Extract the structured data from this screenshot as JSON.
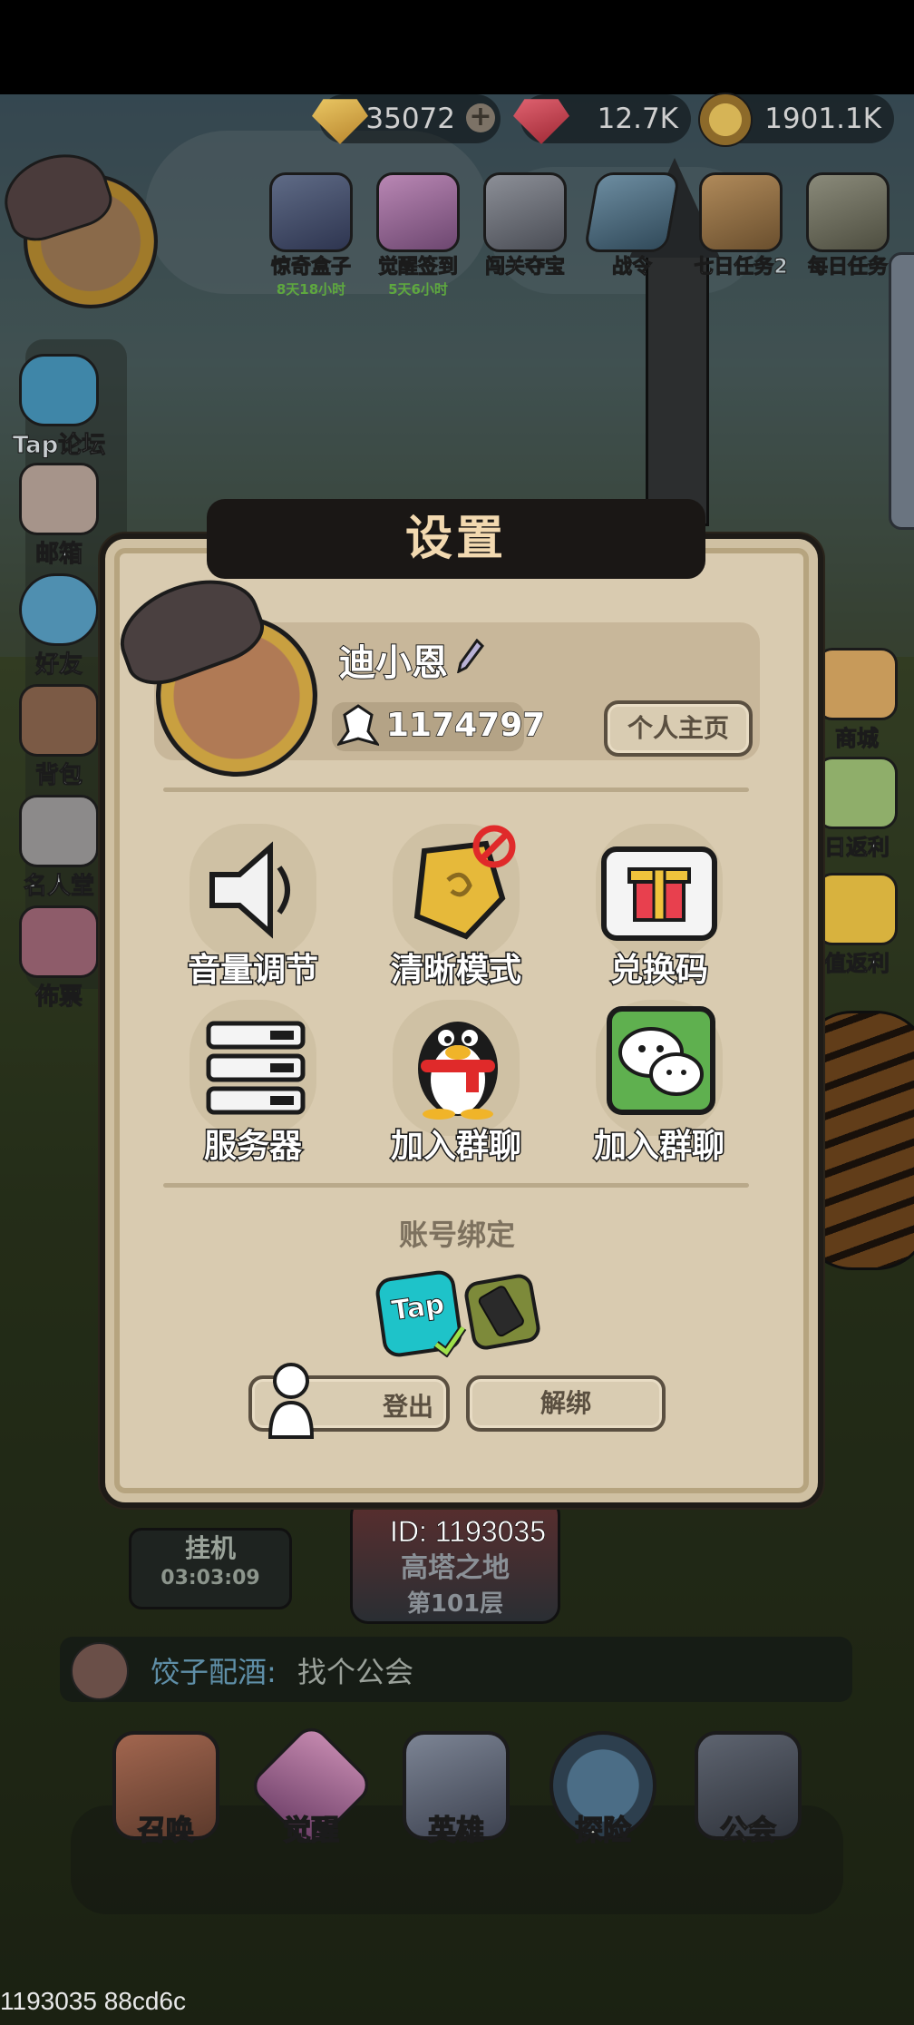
{
  "currency": {
    "gold": "35072",
    "ruby": "12.7K",
    "coin": "1901.1K"
  },
  "events": [
    {
      "label": "惊奇盒子",
      "timer": "8天18小时"
    },
    {
      "label": "觉醒签到",
      "timer": "5天6小时"
    },
    {
      "label": "闯关夺宝",
      "timer": ""
    },
    {
      "label": "战令",
      "timer": ""
    },
    {
      "label": "七日任务2",
      "timer": ""
    },
    {
      "label": "每日任务",
      "timer": ""
    }
  ],
  "side_menu": [
    "Tap论坛",
    "邮箱",
    "好友",
    "背包",
    "名人堂",
    "佈票"
  ],
  "right_menu": [
    "商城",
    "日返利",
    "值返利"
  ],
  "idle": {
    "label": "挂机",
    "time": "03:03:09"
  },
  "tower": {
    "label": "高塔之地",
    "floor": "第101层"
  },
  "chat": {
    "user": "饺子配酒:",
    "message": "找个公会"
  },
  "bottom_nav": [
    "召唤",
    "觉醒",
    "英雄",
    "探险",
    "公会"
  ],
  "dialog": {
    "title": "设置",
    "player_name": "迪小恩",
    "power": "1174797",
    "profile_button": "个人主页",
    "grid": [
      "音量调节",
      "清晰模式",
      "兑换码",
      "服务器",
      "加入群聊",
      "加入群聊"
    ],
    "bind_title": "账号绑定",
    "tap_label": "Tap",
    "logout_button": "登出",
    "unbind_button": "解绑"
  },
  "player_id": "ID: 1193035",
  "debug_text": "1193035 88cd6c",
  "colors": {
    "dialog_bg": "#d9cbb0",
    "title_bar": "#1a1715",
    "title_text": "#f2d9b0",
    "wechat_green": "#5fb04f",
    "qq_scarf": "#e02a2a",
    "gold": "#e6b93a"
  }
}
